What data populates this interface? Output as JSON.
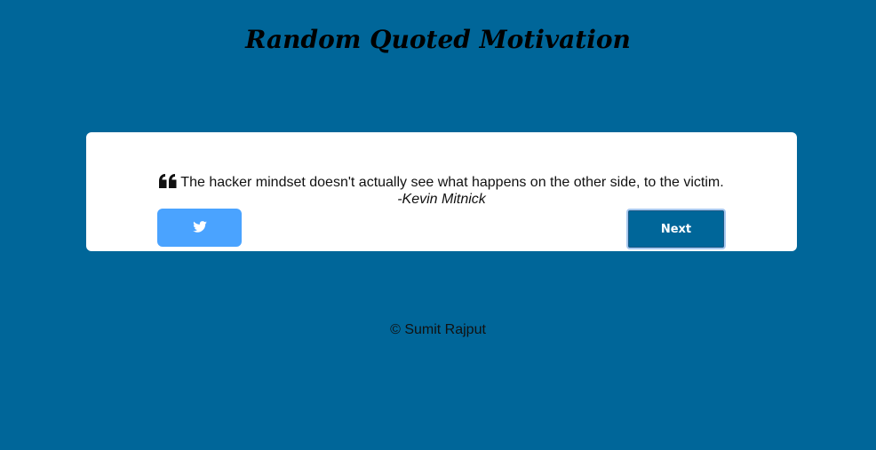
{
  "header": {
    "title": "Random Quoted Motivation"
  },
  "quote": {
    "icon": "quote-left-icon",
    "text": "The hacker mindset doesn't actually see what happens on the other side, to the victim.",
    "author": "-Kevin Mitnick"
  },
  "actions": {
    "tweet_icon": "twitter-icon",
    "next_label": "Next"
  },
  "footer": {
    "copyright": "© Sumit Rajput"
  },
  "colors": {
    "background": "#006699",
    "card": "#ffffff",
    "tweet_button": "#4aa3ff",
    "next_button": "#006699"
  }
}
